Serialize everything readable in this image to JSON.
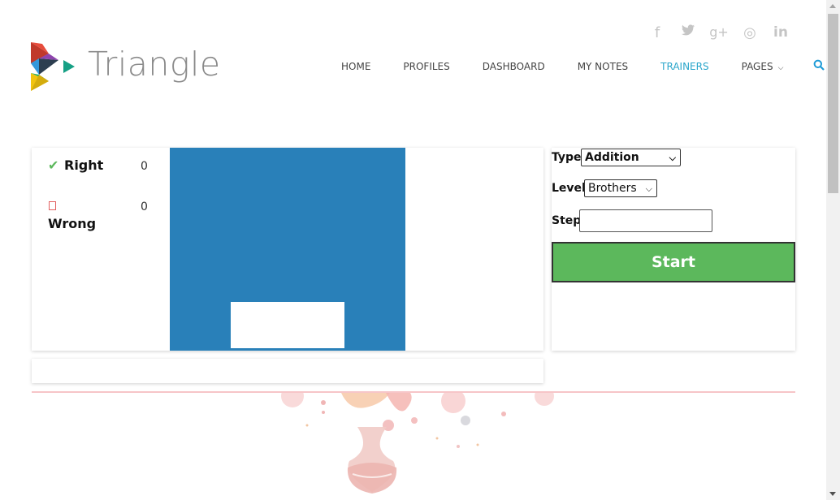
{
  "brand": {
    "name": "Triangle"
  },
  "social": [
    {
      "name": "facebook-icon",
      "glyph": "f"
    },
    {
      "name": "twitter-icon",
      "glyph": "🐦"
    },
    {
      "name": "google-plus-icon",
      "glyph": "g+"
    },
    {
      "name": "dribbble-icon",
      "glyph": "◎"
    },
    {
      "name": "linkedin-icon",
      "glyph": "in"
    }
  ],
  "nav": {
    "home": "HOME",
    "profiles": "PROFILES",
    "dashboard": "DASHBOARD",
    "my_notes": "MY NOTES",
    "trainers": "TRAINERS",
    "pages": "PAGES"
  },
  "score": {
    "right_label": "Right",
    "right_value": "0",
    "wrong_label": "Wrong",
    "wrong_value": "0"
  },
  "settings": {
    "type_label": "Type",
    "type_value": "Addition",
    "level_label": "Level",
    "level_value": "Brothers",
    "step_label": "Step",
    "step_value": "",
    "start_label": "Start"
  },
  "colors": {
    "board": "#2980b9",
    "start": "#5cb85c",
    "active_nav": "#2ba6cb"
  }
}
